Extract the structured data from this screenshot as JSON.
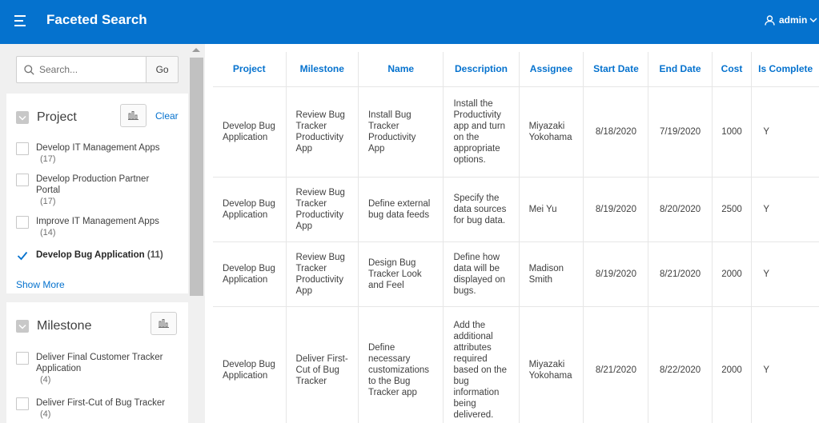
{
  "header": {
    "title": "Faceted Search",
    "user": "admin"
  },
  "sidebar": {
    "search": {
      "placeholder": "Search...",
      "value": "",
      "go_label": "Go"
    },
    "facets": [
      {
        "title": "Project",
        "clear_label": "Clear",
        "show_more_label": "Show More",
        "options": [
          {
            "label": "Develop IT Management Apps",
            "count": "(17)",
            "checked": false
          },
          {
            "label": "Develop Production Partner Portal",
            "count": "(17)",
            "checked": false
          },
          {
            "label": "Improve IT Management Apps",
            "count": "(14)",
            "checked": false
          },
          {
            "label": "Develop Bug Application",
            "count": "(11)",
            "checked": true
          }
        ]
      },
      {
        "title": "Milestone",
        "options": [
          {
            "label": "Deliver Final Customer Tracker Application",
            "count": "(4)",
            "checked": false
          },
          {
            "label": "Deliver First-Cut of Bug Tracker",
            "count": "(4)",
            "checked": false
          }
        ]
      }
    ]
  },
  "table": {
    "columns": [
      "Project",
      "Milestone",
      "Name",
      "Description",
      "Assignee",
      "Start Date",
      "End Date",
      "Cost",
      "Is Complete"
    ],
    "rows": [
      [
        "Develop Bug Application",
        "Review Bug Tracker Productivity App",
        "Install Bug Tracker Productivity App",
        "Install the Productivity app and turn on the appropriate options.",
        "Miyazaki Yokohama",
        "8/18/2020",
        "7/19/2020",
        "1000",
        "Y"
      ],
      [
        "Develop Bug Application",
        "Review Bug Tracker Productivity App",
        "Define external bug data feeds",
        "Specify the data sources for bug data.",
        "Mei Yu",
        "8/19/2020",
        "8/20/2020",
        "2500",
        "Y"
      ],
      [
        "Develop Bug Application",
        "Review Bug Tracker Productivity App",
        "Design Bug Tracker Look and Feel",
        "Define how data will be displayed on bugs.",
        "Madison Smith",
        "8/19/2020",
        "8/21/2020",
        "2000",
        "Y"
      ],
      [
        "Develop Bug Application",
        "Deliver First-Cut of Bug Tracker",
        "Define necessary customizations to the Bug Tracker app",
        "Add the additional attributes required based on the bug information being delivered.",
        "Miyazaki Yokohama",
        "8/21/2020",
        "8/22/2020",
        "2000",
        "Y"
      ]
    ]
  },
  "colors": {
    "header_bg": "#0572ce",
    "accent": "#0572ce",
    "sidebar_bg": "#f0f0f0"
  },
  "icons": [
    "hamburger-icon",
    "user-icon",
    "chevron-down-icon",
    "search-icon",
    "collapse-icon",
    "bar-chart-icon",
    "checkmark-icon"
  ]
}
